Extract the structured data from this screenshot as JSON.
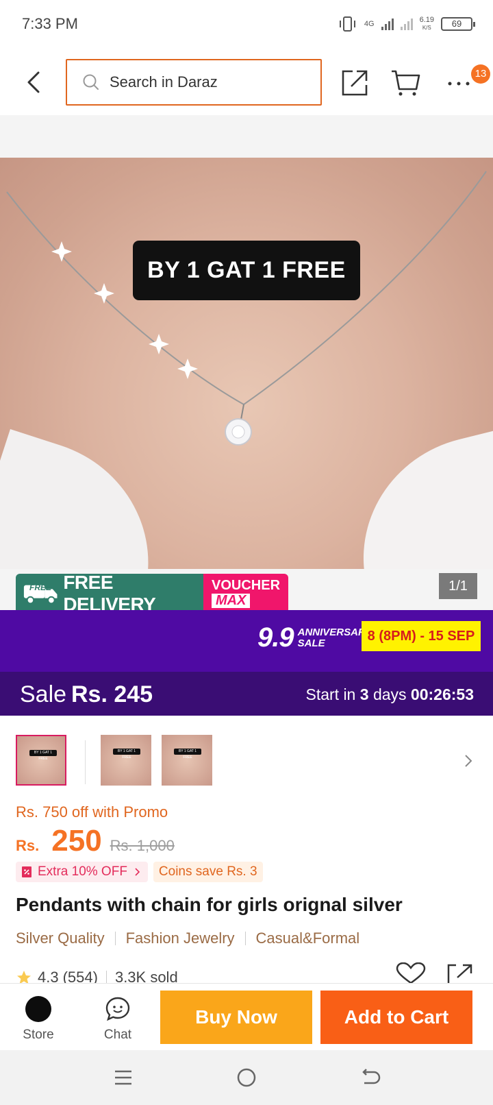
{
  "status_bar": {
    "time": "7:33 PM",
    "network": "4G",
    "speed_value": "6.19",
    "speed_unit": "K/S",
    "battery": "69"
  },
  "top_bar": {
    "search_placeholder": "Search in Daraz",
    "cart_badge": "13"
  },
  "gallery": {
    "promo_label": "BY 1 GAT 1 FREE",
    "counter": "1/1"
  },
  "delivery_banner": {
    "free_tag": "FREE",
    "free_delivery": "FREE DELIVERY",
    "voucher": "VOUCHER",
    "voucher_max": "MAX"
  },
  "campaign": {
    "title_number": "9.9",
    "title_line1": "ANNIVERSARY",
    "title_line2": "SALE",
    "dates": "8 (8PM) - 15 SEP"
  },
  "sale_bar": {
    "label": "Sale",
    "price": "Rs. 245",
    "countdown_prefix": "Start in",
    "days": "3",
    "days_suffix": "days",
    "time": "00:26:53"
  },
  "thumbnails": [
    {
      "text": "BY 1 GAT 1 FREE"
    },
    {
      "text": "BY 1 GAT 1 FREE"
    },
    {
      "text": "BY 1 GAT 1 FREE"
    }
  ],
  "product": {
    "promo_text": "Rs. 750 off with Promo",
    "currency": "Rs.",
    "price": "250",
    "original_price": "Rs. 1,000",
    "tag_extra": "Extra 10% OFF",
    "tag_coins": "Coins save Rs. 3",
    "title": "Pendants with chain for girls orignal silver",
    "features": [
      "Silver Quality",
      "Fashion Jewelry",
      "Casual&Formal"
    ],
    "rating": "4.3",
    "reviews": "(554)",
    "sold": "3.3K sold"
  },
  "bottom_bar": {
    "store": "Store",
    "chat": "Chat",
    "buy_now": "Buy Now",
    "add_to_cart": "Add to Cart"
  },
  "colors": {
    "accent": "#f57224",
    "campaign": "#4f0aa3",
    "sale_bar": "#3a0d74",
    "buy_now": "#faa61a",
    "add_to_cart": "#f95f16"
  }
}
